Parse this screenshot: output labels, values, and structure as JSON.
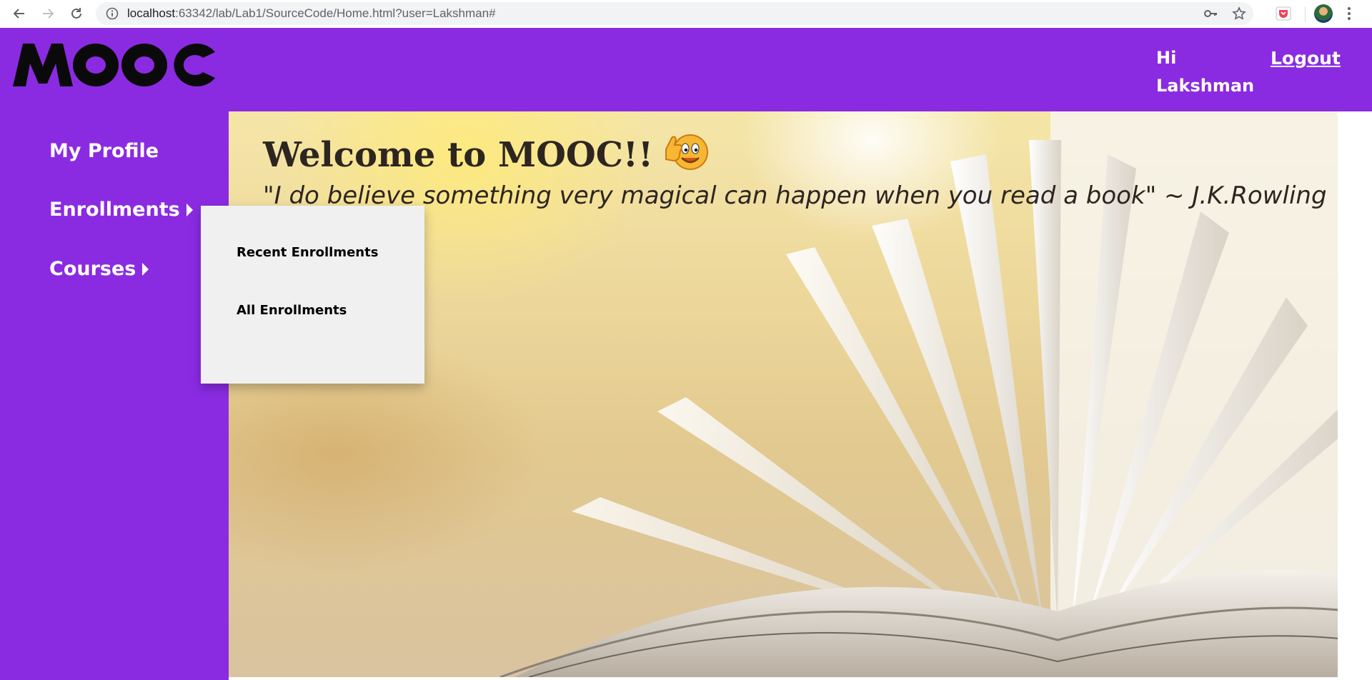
{
  "browser": {
    "url_host": "localhost",
    "url_rest": ":63342/lab/Lab1/SourceCode/Home.html?user=Lakshman#",
    "icons": [
      "back-arrow-icon",
      "forward-arrow-icon",
      "reload-icon",
      "info-icon",
      "key-icon",
      "star-icon",
      "pocket-icon",
      "profile-avatar",
      "menu-dots-icon"
    ]
  },
  "header": {
    "logo_text": "MOOC",
    "greeting": "Hi Lakshman",
    "logout_label": "Logout"
  },
  "sidebar": {
    "items": [
      {
        "label": "My Profile",
        "has_submenu": false
      },
      {
        "label": "Enrollments",
        "has_submenu": true
      },
      {
        "label": "Courses",
        "has_submenu": true
      }
    ]
  },
  "enrollments_menu": {
    "items": [
      "Recent Enrollments",
      "All Enrollments"
    ]
  },
  "main": {
    "welcome": "Welcome to MOOC!!",
    "quote": "\"I do believe something very magical can happen when you read a book\" ~ J.K.Rowling"
  },
  "colors": {
    "brand_purple": "#8a2be2",
    "dropdown_bg": "#f0f0f0",
    "text_dark": "#2d2520"
  }
}
